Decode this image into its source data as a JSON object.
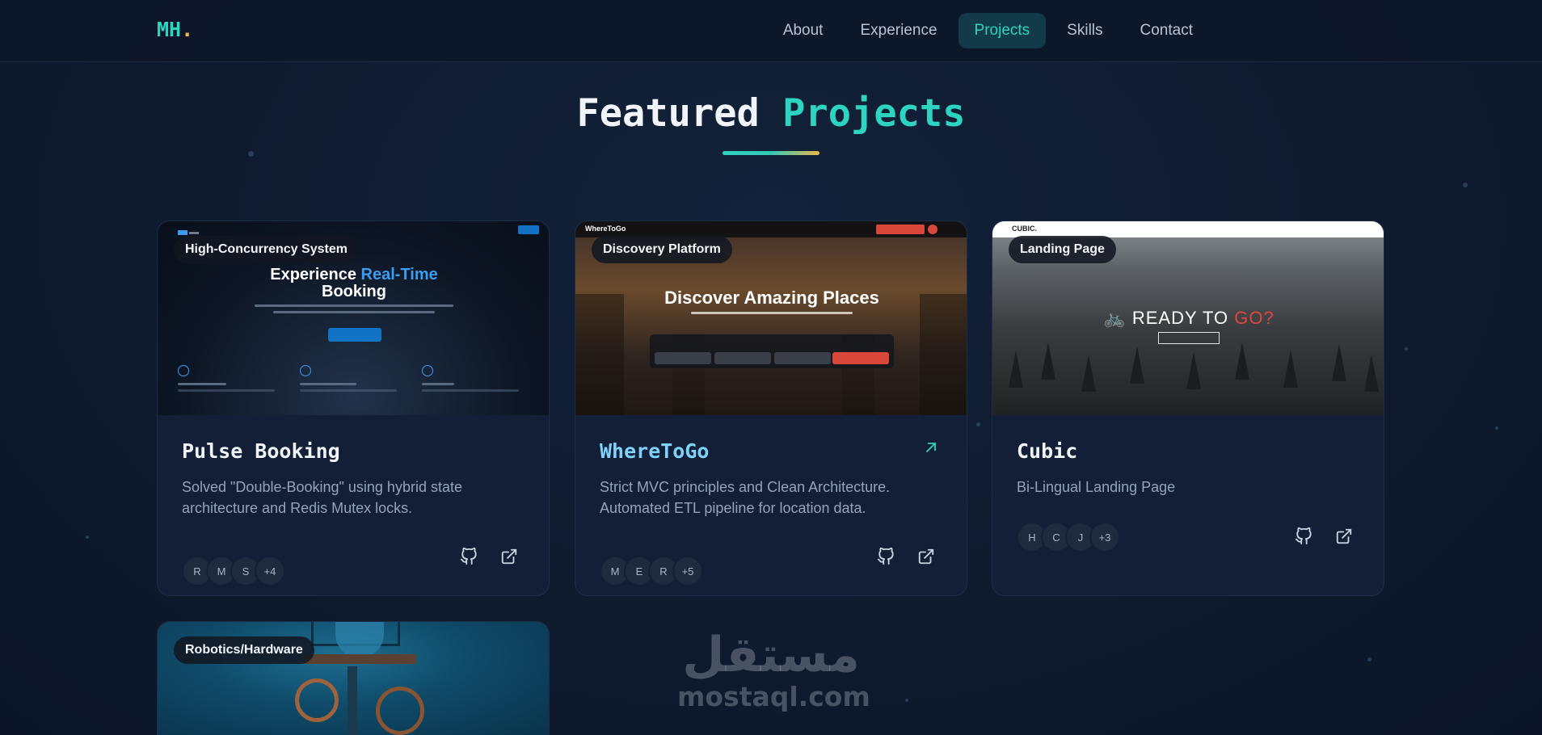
{
  "nav": {
    "logo": "MH",
    "logo_dot": ".",
    "links": [
      "About",
      "Experience",
      "Projects",
      "Skills",
      "Contact"
    ],
    "active": "Projects"
  },
  "section": {
    "title_part1": "Featured",
    "title_part2": "Projects"
  },
  "projects": [
    {
      "badge": "High-Concurrency System",
      "title": "Pulse Booking",
      "description": "Solved \"Double-Booking\" using hybrid state architecture and Redis Mutex locks.",
      "avatars": [
        "R",
        "M",
        "S",
        "+4"
      ],
      "preview": {
        "heading_part1": "Experience",
        "heading_accent": "Real-Time",
        "heading_part2": "Booking"
      }
    },
    {
      "badge": "Discovery Platform",
      "title": "WhereToGo",
      "description": "Strict MVC principles and Clean Architecture. Automated ETL pipeline for location data.",
      "avatars": [
        "M",
        "E",
        "R",
        "+5"
      ],
      "preview": {
        "heading": "Discover Amazing Places",
        "brand": "WhereToGo"
      }
    },
    {
      "badge": "Landing Page",
      "title": "Cubic",
      "description": "Bi-Lingual Landing Page",
      "avatars": [
        "H",
        "C",
        "J",
        "+3"
      ],
      "preview": {
        "brand": "CUBIC.",
        "heading_part1": "READY TO",
        "heading_accent": "GO?"
      }
    },
    {
      "badge": "Robotics/Hardware"
    }
  ],
  "watermark": {
    "arabic": "مستقل",
    "latin": "mostaql.com"
  },
  "colors": {
    "background": "#0e1a2e",
    "accent": "#2dd4bf",
    "accent_gold": "#e9b949",
    "card": "#131f36"
  },
  "icons": [
    "github-icon",
    "external-link-icon",
    "arrow-up-right-icon"
  ]
}
